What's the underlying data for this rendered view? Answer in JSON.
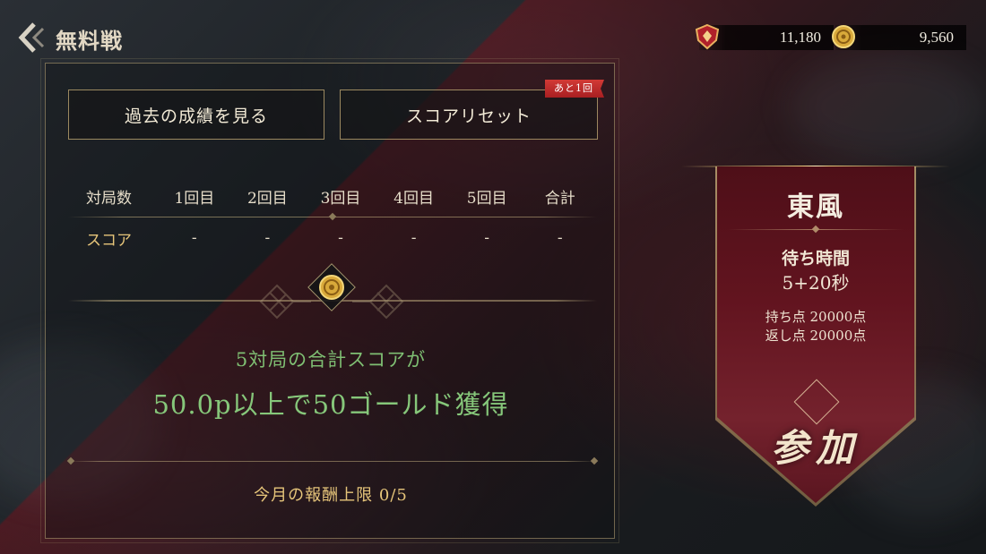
{
  "header": {
    "title": "無料戦",
    "back_icon": "chevron-left-icon"
  },
  "currencies": {
    "ruby": {
      "icon": "ruby-shield-icon",
      "value": "11,180"
    },
    "gold": {
      "icon": "gold-coin-icon",
      "value": "9,560"
    }
  },
  "buttons": {
    "history_label": "過去の成績を見る",
    "reset_label": "スコアリセット",
    "reset_badge": "あと1回"
  },
  "score_table": {
    "headers": [
      "対局数",
      "1回目",
      "2回目",
      "3回目",
      "4回目",
      "5回目",
      "合計"
    ],
    "row_label": "スコア",
    "values": [
      "-",
      "-",
      "-",
      "-",
      "-",
      "-"
    ]
  },
  "reward": {
    "line1": "5対局の合計スコアが",
    "line2": "50.0p以上で50ゴールド獲得"
  },
  "monthly_limit": "今月の報酬上限 0/5",
  "mode_banner": {
    "title": "東風",
    "wait_label": "待ち時間",
    "wait_value": "5+20秒",
    "points_start": "持ち点 20000点",
    "points_return": "返し点 20000点",
    "join_label": "参加"
  },
  "colors": {
    "accent_green": "#86c77a",
    "accent_gold": "#e6c57a",
    "banner_red": "#6b1622",
    "badge_red": "#c12d2c"
  }
}
